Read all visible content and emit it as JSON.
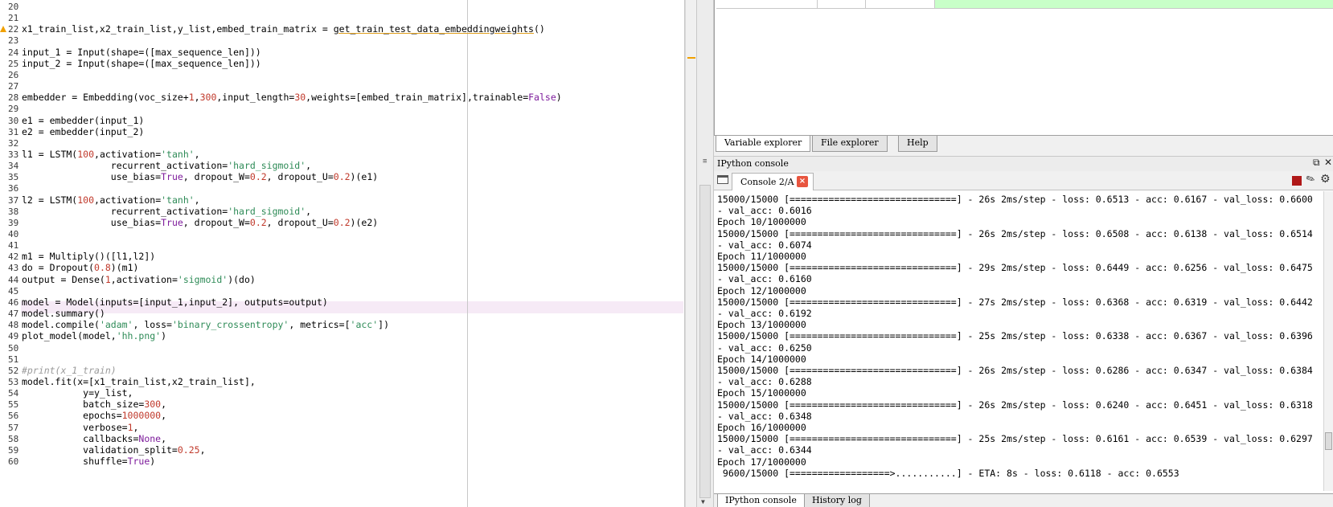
{
  "editor": {
    "first_line_partial": "—",
    "lines": [
      {
        "n": "20",
        "code": ""
      },
      {
        "n": "21",
        "code": ""
      },
      {
        "n": "22",
        "code": "x1_train_list,x2_train_list,y_list,embed_train_matrix = get_train_test_data_embeddingweights()"
      },
      {
        "n": "23",
        "code": ""
      },
      {
        "n": "24",
        "code": "input_1 = Input(shape=([max_sequence_len]))"
      },
      {
        "n": "25",
        "code": "input_2 = Input(shape=([max_sequence_len]))"
      },
      {
        "n": "26",
        "code": ""
      },
      {
        "n": "27",
        "code": ""
      },
      {
        "n": "28",
        "code": "embedder = Embedding(voc_size+1,300,input_length=30,weights=[embed_train_matrix],trainable=False)"
      },
      {
        "n": "29",
        "code": ""
      },
      {
        "n": "30",
        "code": "e1 = embedder(input_1)"
      },
      {
        "n": "31",
        "code": "e2 = embedder(input_2)"
      },
      {
        "n": "32",
        "code": ""
      },
      {
        "n": "33",
        "code": "l1 = LSTM(100,activation='tanh',"
      },
      {
        "n": "34",
        "code": "                recurrent_activation='hard_sigmoid',"
      },
      {
        "n": "35",
        "code": "                use_bias=True, dropout_W=0.2, dropout_U=0.2)(e1)"
      },
      {
        "n": "36",
        "code": ""
      },
      {
        "n": "37",
        "code": "l2 = LSTM(100,activation='tanh',"
      },
      {
        "n": "38",
        "code": "                recurrent_activation='hard_sigmoid',"
      },
      {
        "n": "39",
        "code": "                use_bias=True, dropout_W=0.2, dropout_U=0.2)(e2)"
      },
      {
        "n": "40",
        "code": ""
      },
      {
        "n": "41",
        "code": ""
      },
      {
        "n": "42",
        "code": "m1 = Multiply()([l1,l2])"
      },
      {
        "n": "43",
        "code": "do = Dropout(0.8)(m1)"
      },
      {
        "n": "44",
        "code": "output = Dense(1,activation='sigmoid')(do)"
      },
      {
        "n": "45",
        "code": ""
      },
      {
        "n": "46",
        "code": "model = Model(inputs=[input_1,input_2], outputs=output)"
      },
      {
        "n": "47",
        "code": "model.summary()"
      },
      {
        "n": "48",
        "code": "model.compile('adam', loss='binary_crossentropy', metrics=['acc'])"
      },
      {
        "n": "49",
        "code": "plot_model(model,'hh.png')"
      },
      {
        "n": "50",
        "code": ""
      },
      {
        "n": "51",
        "code": ""
      },
      {
        "n": "52",
        "code": "#print(x_1_train)"
      },
      {
        "n": "53",
        "code": "model.fit(x=[x1_train_list,x2_train_list],"
      },
      {
        "n": "54",
        "code": "           y=y_list,"
      },
      {
        "n": "55",
        "code": "           batch_size=300,"
      },
      {
        "n": "56",
        "code": "           epochs=1000000,"
      },
      {
        "n": "57",
        "code": "           verbose=1,"
      },
      {
        "n": "58",
        "code": "           callbacks=None,"
      },
      {
        "n": "59",
        "code": "           validation_split=0.25,"
      },
      {
        "n": "60",
        "code": "           shuffle=True)"
      }
    ]
  },
  "variable_explorer": {
    "tabs": [
      "Variable explorer",
      "File explorer",
      "Help"
    ],
    "active_tab": "Variable explorer",
    "row_colors": {
      "highlight": "#c8ffc8"
    }
  },
  "console": {
    "pane_title": "IPython console",
    "tab_label": "Console 2/A",
    "close_glyph": "×",
    "output_lines": [
      "15000/15000 [==============================] - 26s 2ms/step - loss: 0.6513 - acc: 0.6167 - val_loss: 0.6600",
      "- val_acc: 0.6016",
      "Epoch 10/1000000",
      "15000/15000 [==============================] - 26s 2ms/step - loss: 0.6508 - acc: 0.6138 - val_loss: 0.6514",
      "- val_acc: 0.6074",
      "Epoch 11/1000000",
      "15000/15000 [==============================] - 29s 2ms/step - loss: 0.6449 - acc: 0.6256 - val_loss: 0.6475",
      "- val_acc: 0.6160",
      "Epoch 12/1000000",
      "15000/15000 [==============================] - 27s 2ms/step - loss: 0.6368 - acc: 0.6319 - val_loss: 0.6442",
      "- val_acc: 0.6192",
      "Epoch 13/1000000",
      "15000/15000 [==============================] - 25s 2ms/step - loss: 0.6338 - acc: 0.6367 - val_loss: 0.6396",
      "- val_acc: 0.6250",
      "Epoch 14/1000000",
      "15000/15000 [==============================] - 26s 2ms/step - loss: 0.6286 - acc: 0.6347 - val_loss: 0.6384",
      "- val_acc: 0.6288",
      "Epoch 15/1000000",
      "15000/15000 [==============================] - 26s 2ms/step - loss: 0.6240 - acc: 0.6451 - val_loss: 0.6318",
      "- val_acc: 0.6348",
      "Epoch 16/1000000",
      "15000/15000 [==============================] - 25s 2ms/step - loss: 0.6161 - acc: 0.6539 - val_loss: 0.6297",
      "- val_acc: 0.6344",
      "Epoch 17/1000000",
      " 9600/15000 [==================>...........] - ETA: 8s - loss: 0.6118 - acc: 0.6553"
    ],
    "bottom_tabs": [
      "IPython console",
      "History log"
    ],
    "active_bottom_tab": "IPython console"
  },
  "icons": {
    "warning": "warning-icon",
    "folder": "folder-icon",
    "stop": "stop-icon",
    "eraser": "eraser-icon",
    "gear": "gear-icon",
    "undock": "undock-icon",
    "close": "close-icon"
  },
  "colors": {
    "number": "#c0392b",
    "string": "#2e8b57",
    "keyword": "#7d1b9b",
    "current_line": "#f6eaf6",
    "stop_button": "#b01818"
  }
}
